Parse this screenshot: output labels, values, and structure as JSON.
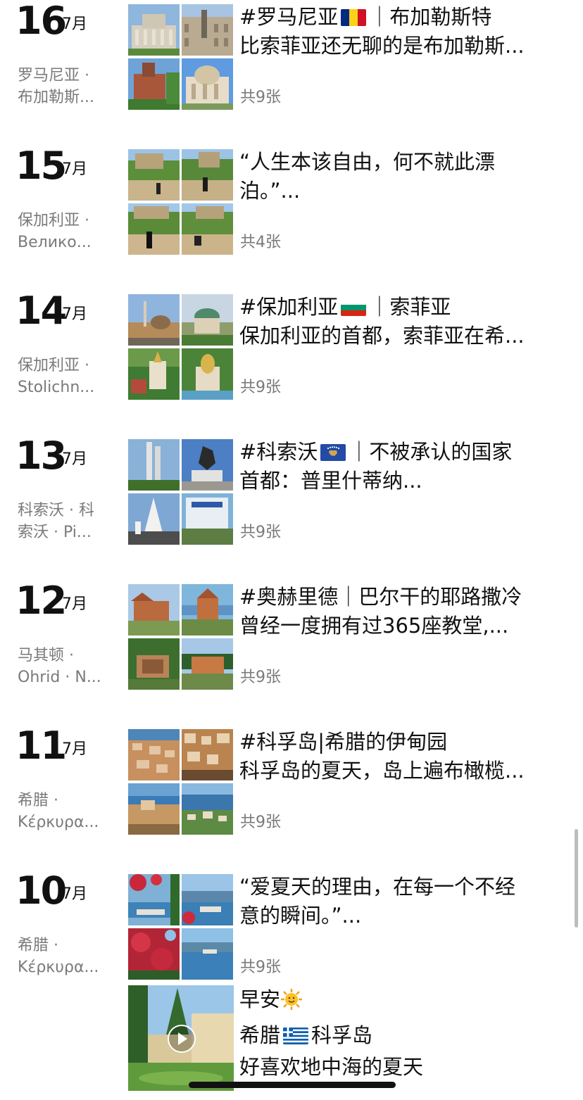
{
  "entries": [
    {
      "day": "16",
      "month": "7月",
      "loc1": "罗马尼亚 ·",
      "loc2": "布加勒斯...",
      "line1": "#罗马尼亚",
      "line1b": "｜布加勒斯特",
      "line2": "比索菲亚还无聊的是布加勒斯...",
      "flag": "romania-flag-icon",
      "count": "共9张"
    },
    {
      "day": "15",
      "month": "7月",
      "loc1": "保加利亚 ·",
      "loc2": "Велико...",
      "line1": "“人生本该自由，何不就此漂",
      "line1b": "",
      "line2": "泊。”...",
      "flag": "",
      "count": "共4张"
    },
    {
      "day": "14",
      "month": "7月",
      "loc1": "保加利亚 ·",
      "loc2": "Stolichn...",
      "line1": "#保加利亚",
      "line1b": "｜索菲亚",
      "line2": "保加利亚的首都，索菲亚在希...",
      "flag": "bulgaria-flag-icon",
      "count": "共9张"
    },
    {
      "day": "13",
      "month": "7月",
      "loc1": "科索沃 · 科",
      "loc2": "索沃 · Pi...",
      "line1": "#科索沃",
      "line1b": "｜不被承认的国家",
      "line2": "首都：普里什蒂纳...",
      "flag": "kosovo-flag-icon",
      "count": "共9张"
    },
    {
      "day": "12",
      "month": "7月",
      "loc1": "马其顿 ·",
      "loc2": "Ohrid · N...",
      "line1": "#奥赫里德｜巴尔干的耶路撒冷",
      "line1b": "",
      "line2": "曾经一度拥有过365座教堂,...",
      "flag": "",
      "count": "共9张"
    },
    {
      "day": "11",
      "month": "7月",
      "loc1": "希腊 ·",
      "loc2": "Κέρκυρα...",
      "line1": "#科孚岛|希腊的伊甸园",
      "line1b": "",
      "line2": "科孚岛的夏天，岛上遍布橄榄...",
      "flag": "",
      "count": "共9张"
    },
    {
      "day": "10",
      "month": "7月",
      "loc1": "希腊 ·",
      "loc2": "Κέρκυρα...",
      "line1": "“爱夏天的理由，在每一个不经",
      "line1b": "",
      "line2": "意的瞬间。”...",
      "flag": "",
      "count": "共9张"
    }
  ],
  "video_post": {
    "line1": "早安",
    "line2a": "希腊",
    "line2b": "科孚岛",
    "line3": "好喜欢地中海的夏天"
  },
  "colors": {
    "text": "#111111",
    "muted": "#7a7a7a"
  }
}
